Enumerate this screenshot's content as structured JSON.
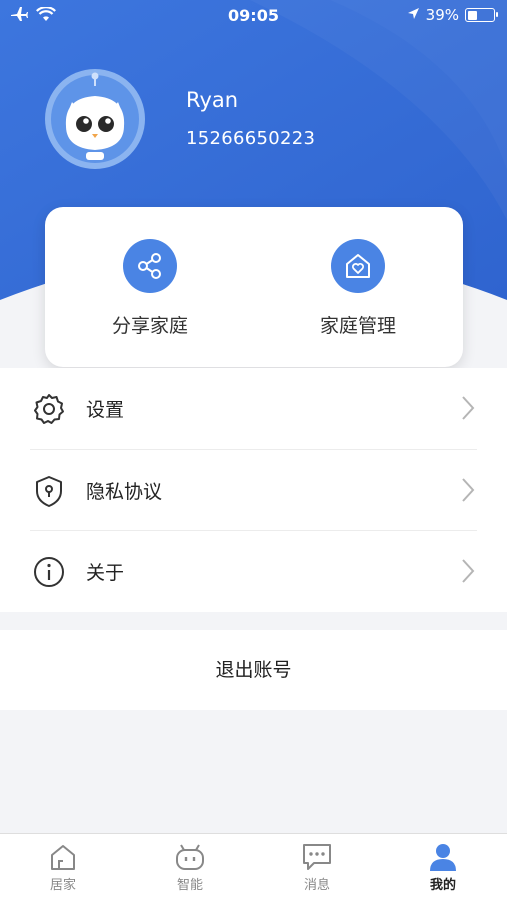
{
  "status_bar": {
    "time": "09:05",
    "battery": "39%",
    "battery_fraction": 0.39
  },
  "profile": {
    "name": "Ryan",
    "phone": "15266650223"
  },
  "card": {
    "share": {
      "label": "分享家庭",
      "icon": "share-icon"
    },
    "manage": {
      "label": "家庭管理",
      "icon": "home-heart-icon"
    }
  },
  "menu": {
    "items": [
      {
        "label": "设置",
        "icon": "gear-icon"
      },
      {
        "label": "隐私协议",
        "icon": "shield-icon"
      },
      {
        "label": "关于",
        "icon": "info-icon"
      }
    ]
  },
  "logout_label": "退出账号",
  "tabs": [
    {
      "label": "居家",
      "icon": "home-icon",
      "active": false
    },
    {
      "label": "智能",
      "icon": "robot-icon",
      "active": false
    },
    {
      "label": "消息",
      "icon": "message-icon",
      "active": false
    },
    {
      "label": "我的",
      "icon": "user-icon",
      "active": true
    }
  ],
  "colors": {
    "brand_blue": "#3b73dd",
    "accent_blue": "#4a84e4"
  }
}
